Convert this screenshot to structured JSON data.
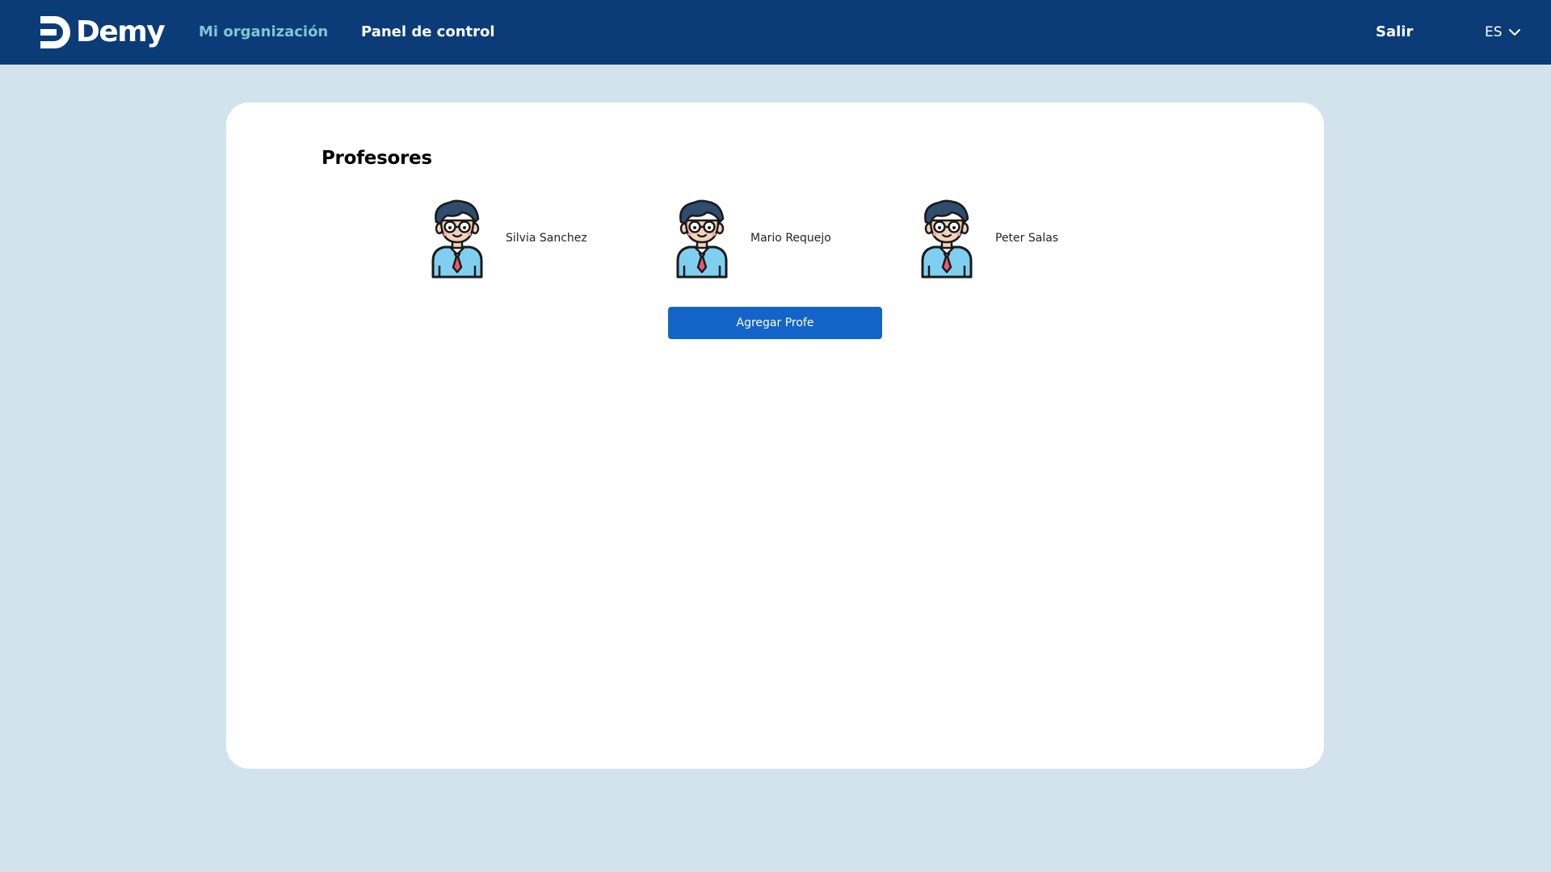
{
  "header": {
    "brand": "Demy",
    "nav": [
      {
        "label": "Mi organización",
        "active": true
      },
      {
        "label": "Panel de control",
        "active": false
      }
    ],
    "logout_label": "Salir",
    "language": "ES",
    "colors": {
      "bar": "#0b3c78",
      "active_link": "#7fc6d4"
    }
  },
  "main": {
    "title": "Profesores",
    "teachers": [
      {
        "name": "Silvia Sanchez",
        "icon": "teacher-avatar-icon"
      },
      {
        "name": "Mario Requejo",
        "icon": "teacher-avatar-icon"
      },
      {
        "name": "Peter Salas",
        "icon": "teacher-avatar-icon"
      }
    ],
    "add_button_label": "Agregar Profe",
    "colors": {
      "button": "#1264c8",
      "background": "#d2e3ee"
    }
  }
}
